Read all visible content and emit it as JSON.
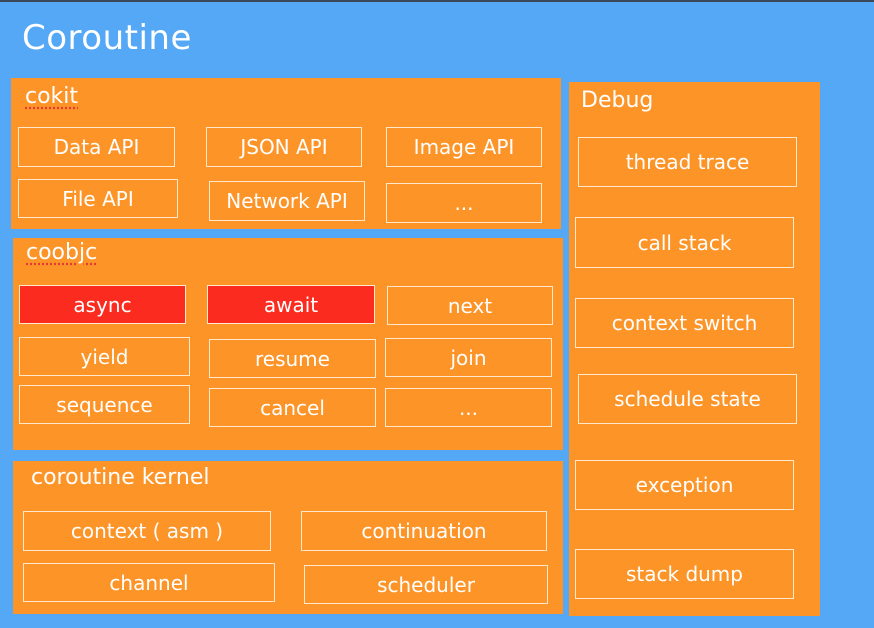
{
  "title": "Coroutine",
  "colors": {
    "background": "#55a8f5",
    "panel": "#fd9428",
    "highlight": "#fc2b1f",
    "text": "#ffffff"
  },
  "cokit": {
    "title": "cokit",
    "items": [
      "Data API",
      "JSON API",
      "Image API",
      "File API",
      "Network API",
      "..."
    ]
  },
  "coobjc": {
    "title": "coobjc",
    "items": [
      "async",
      "await",
      "next",
      "yield",
      "resume",
      "join",
      "sequence",
      "cancel",
      "..."
    ],
    "highlighted": [
      "async",
      "await"
    ]
  },
  "kernel": {
    "title": "coroutine kernel",
    "items": [
      "context ( asm )",
      "continuation",
      "channel",
      "scheduler"
    ]
  },
  "debug": {
    "title": "Debug",
    "items": [
      "thread trace",
      "call stack",
      "context switch",
      "schedule state",
      "exception",
      "stack dump"
    ]
  }
}
